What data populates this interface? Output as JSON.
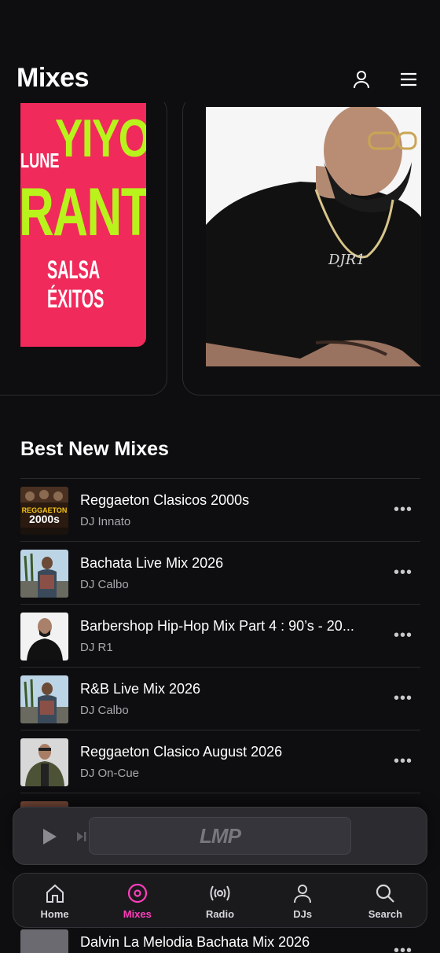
{
  "header": {
    "title": "Mixes"
  },
  "colors": {
    "accent": "#ff3dbb",
    "background": "#0e0e10",
    "cover_pink": "#f02a5a",
    "cover_lime": "#b9f31c"
  },
  "carousel": {
    "left_cover": {
      "line1": "YIYO",
      "line0": "LUNE",
      "line2": "RANTE",
      "line3": "SALSA ÉXITOS"
    }
  },
  "best_new_mixes": {
    "title": "Best New Mixes",
    "items": [
      {
        "title": "Reggaeton Clasicos 2000s",
        "dj": "DJ Innato",
        "thumb_text": "REGGAETON 2000s"
      },
      {
        "title": "Bachata Live Mix 2026",
        "dj": "DJ Calbo"
      },
      {
        "title": "Barbershop Hip-Hop Mix Part 4 : 90’s - 20...",
        "dj": "DJ R1"
      },
      {
        "title": "R&B Live Mix 2026",
        "dj": "DJ Calbo"
      },
      {
        "title": "Reggaeton Clasico August 2026",
        "dj": "DJ On-Cue"
      }
    ],
    "partial_item": {
      "title": "Dalvin La Melodia Bachata Mix 2026"
    }
  },
  "player": {
    "logo": "LMP"
  },
  "tabbar": {
    "tabs": [
      {
        "label": "Home",
        "icon": "home-icon"
      },
      {
        "label": "Mixes",
        "icon": "mixes-icon",
        "active": true
      },
      {
        "label": "Radio",
        "icon": "radio-icon"
      },
      {
        "label": "DJs",
        "icon": "user-icon"
      },
      {
        "label": "Search",
        "icon": "search-icon"
      }
    ]
  }
}
